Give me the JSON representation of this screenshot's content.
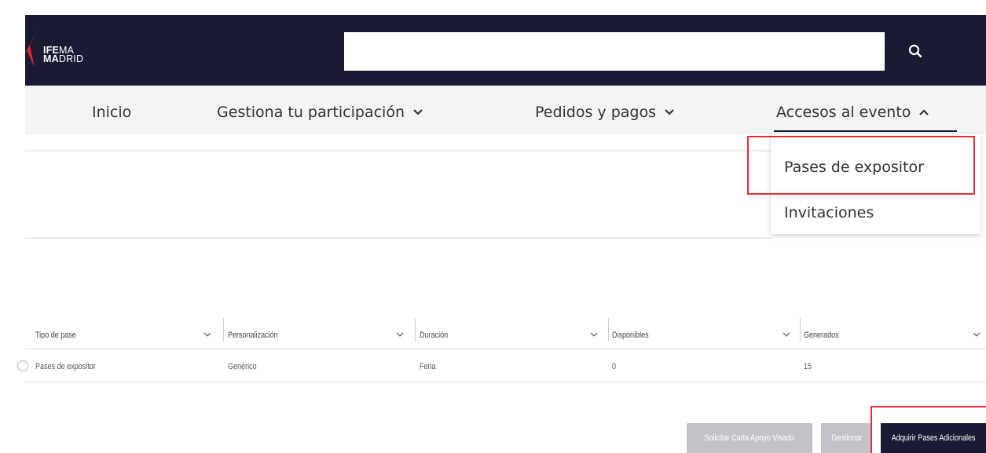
{
  "header": {
    "logo": {
      "line1_bold": "IFE",
      "line1_rest": "MA",
      "line2_bold": "MA",
      "line2_rest": "DRID"
    },
    "search": {
      "placeholder": "",
      "value": ""
    },
    "icons": {
      "search": "search-icon"
    }
  },
  "nav": {
    "items": [
      {
        "label": "Inicio"
      },
      {
        "label": "Gestiona tu participación",
        "icon": "chevron-down-icon"
      },
      {
        "label": "Pedidos y pagos",
        "icon": "chevron-down-icon"
      },
      {
        "label": "Accesos al evento",
        "icon": "chevron-up-icon",
        "active": true
      }
    ],
    "dropdown": {
      "items": [
        {
          "label": "Pases de expositor",
          "highlighted": true
        },
        {
          "label": "Invitaciones"
        }
      ]
    }
  },
  "table": {
    "columns": [
      "Tipo de pase",
      "Personalización",
      "Duración",
      "Disponibles",
      "Generados"
    ],
    "rows": [
      {
        "cells": [
          "Pases de expositor",
          "Genérico",
          "Feria",
          "0",
          "15"
        ]
      }
    ]
  },
  "actions": {
    "request_letter": "Solicitar Carta Apoyo Visado",
    "manage": "Gestionar",
    "acquire": "Adquirir Pases Adicionales"
  },
  "colors": {
    "header_bg": "#1a1a33",
    "nav_bg": "#f4f4f6",
    "highlight": "#e02e36",
    "brand_red": "#d9262e",
    "button_disabled": "#c2c2c8"
  }
}
